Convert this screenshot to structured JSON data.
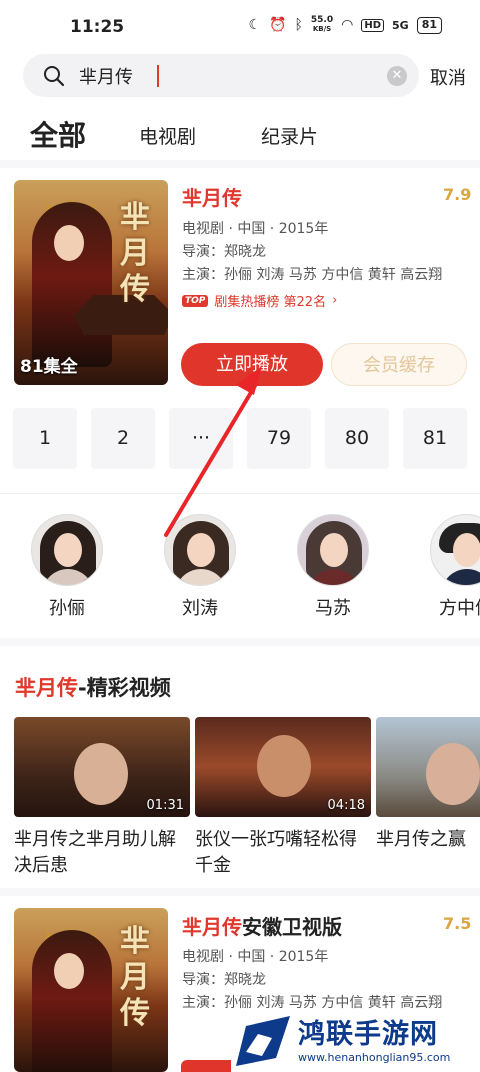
{
  "status_bar": {
    "time": "11:25",
    "net_speed": "55.0",
    "net_unit": "KB/S",
    "hd": "HD",
    "signal": "5G",
    "battery": "81"
  },
  "search": {
    "query": "芈月传",
    "cancel_label": "取消"
  },
  "tabs": [
    {
      "label": "全部",
      "active": true
    },
    {
      "label": "电视剧",
      "active": false
    },
    {
      "label": "纪录片",
      "active": false
    }
  ],
  "result": {
    "title": "芈月传",
    "score": "7.9",
    "episodes_badge": "81集全",
    "meta_line": "电视剧 · 中国 · 2015年",
    "director": "导演：郑晓龙",
    "cast_line": "主演：孙俪 刘涛 马苏 方中信 黄轩 高云翔 ",
    "rank_badge": "TOP",
    "rank_text": "剧集热播榜 第22名",
    "rank_arrow": "›",
    "play_label": "立即播放",
    "cache_label": "会员缓存",
    "poster_calligraphy": "芈月传",
    "episode_buttons": [
      "1",
      "2",
      "···",
      "79",
      "80",
      "81"
    ]
  },
  "cast": [
    {
      "name": "孙俪"
    },
    {
      "name": "刘涛"
    },
    {
      "name": "马苏"
    },
    {
      "name": "方中信"
    }
  ],
  "section": {
    "title_highlight": "芈月传",
    "title_rest": "-精彩视频"
  },
  "videos": [
    {
      "caption": "芈月传之芈月助儿解决后患",
      "duration": "01:31"
    },
    {
      "caption": "张仪一张巧嘴轻松得千金",
      "duration": "04:18"
    },
    {
      "caption": "芈月传之赢",
      "duration": ""
    }
  ],
  "result2": {
    "title_highlight": "芈月传",
    "title_rest": "安徽卫视版",
    "score": "7.5",
    "meta_line": "电视剧 · 中国 · 2015年",
    "director": "导演：郑晓龙",
    "cast_line": "主演：孙俪 刘涛 马苏 方中信 黄轩 高云翔 ",
    "poster_calligraphy": "芈月传"
  },
  "watermark": {
    "name": "鸿联手游网",
    "url": "www.henanhonglian95.com"
  },
  "colors": {
    "accent_red": "#e0382c",
    "score_gold": "#d9a640",
    "watermark_blue": "#0d3a8a"
  }
}
